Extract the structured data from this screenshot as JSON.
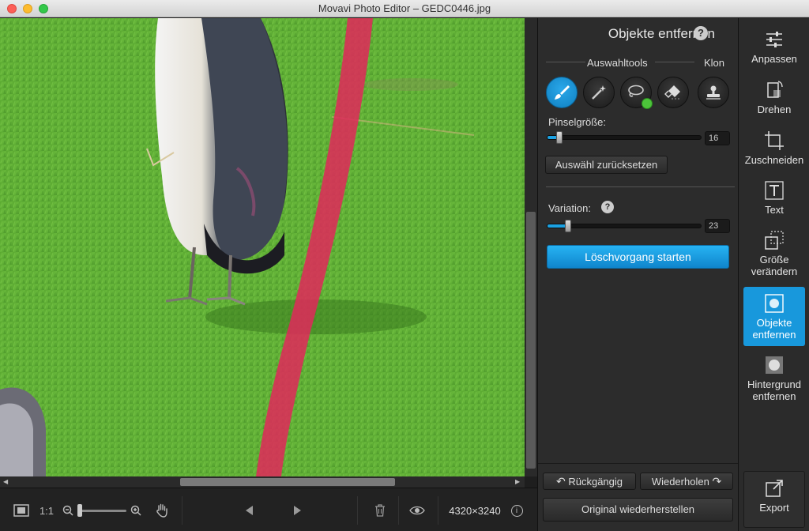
{
  "window": {
    "title": "Movavi Photo Editor – GEDC0446.jpg"
  },
  "panel": {
    "title": "Objekte entfernen",
    "help": "?",
    "selection_tools_label": "Auswahltools",
    "clone_label": "Klon",
    "brush_size_label": "Pinselgröße:",
    "brush_size_value": "16",
    "reset_selection_label": "Auswähl zurücksetzen",
    "variation_label": "Variation:",
    "variation_help": "?",
    "variation_value": "23",
    "start_button_label": "Löschvorgang starten",
    "undo_label": "Rückgängig",
    "redo_label": "Wiederholen",
    "restore_label": "Original wiederherstellen",
    "tools": [
      {
        "name": "brush",
        "icon": "brush-icon",
        "active": true
      },
      {
        "name": "magic-wand",
        "icon": "magic-wand-icon",
        "active": false
      },
      {
        "name": "lasso",
        "icon": "lasso-icon",
        "active": false
      },
      {
        "name": "eraser",
        "icon": "eraser-icon",
        "active": false
      },
      {
        "name": "clone-stamp",
        "icon": "stamp-icon",
        "active": false
      }
    ],
    "sliders": {
      "brush_size_fraction": 0.08,
      "variation_fraction": 0.14
    }
  },
  "sidebar": {
    "items": [
      {
        "label": "Anpassen",
        "icon": "adjust-icon"
      },
      {
        "label": "Drehen",
        "icon": "rotate-icon"
      },
      {
        "label": "Zuschneiden",
        "icon": "crop-icon"
      },
      {
        "label": "Text",
        "icon": "text-icon"
      },
      {
        "label": "Größe verändern",
        "icon": "resize-icon"
      },
      {
        "label": "Objekte entfernen",
        "icon": "object-removal-icon",
        "active": true
      },
      {
        "label": "Hintergrund entfernen",
        "icon": "background-removal-icon"
      }
    ],
    "export_label": "Export"
  },
  "bottombar": {
    "zoom_ratio": "1:1",
    "image_size": "4320×3240",
    "info": "i"
  },
  "colors": {
    "accent": "#1898dc",
    "selection_overlay": "#e0285a",
    "grass": "#5fae34"
  }
}
